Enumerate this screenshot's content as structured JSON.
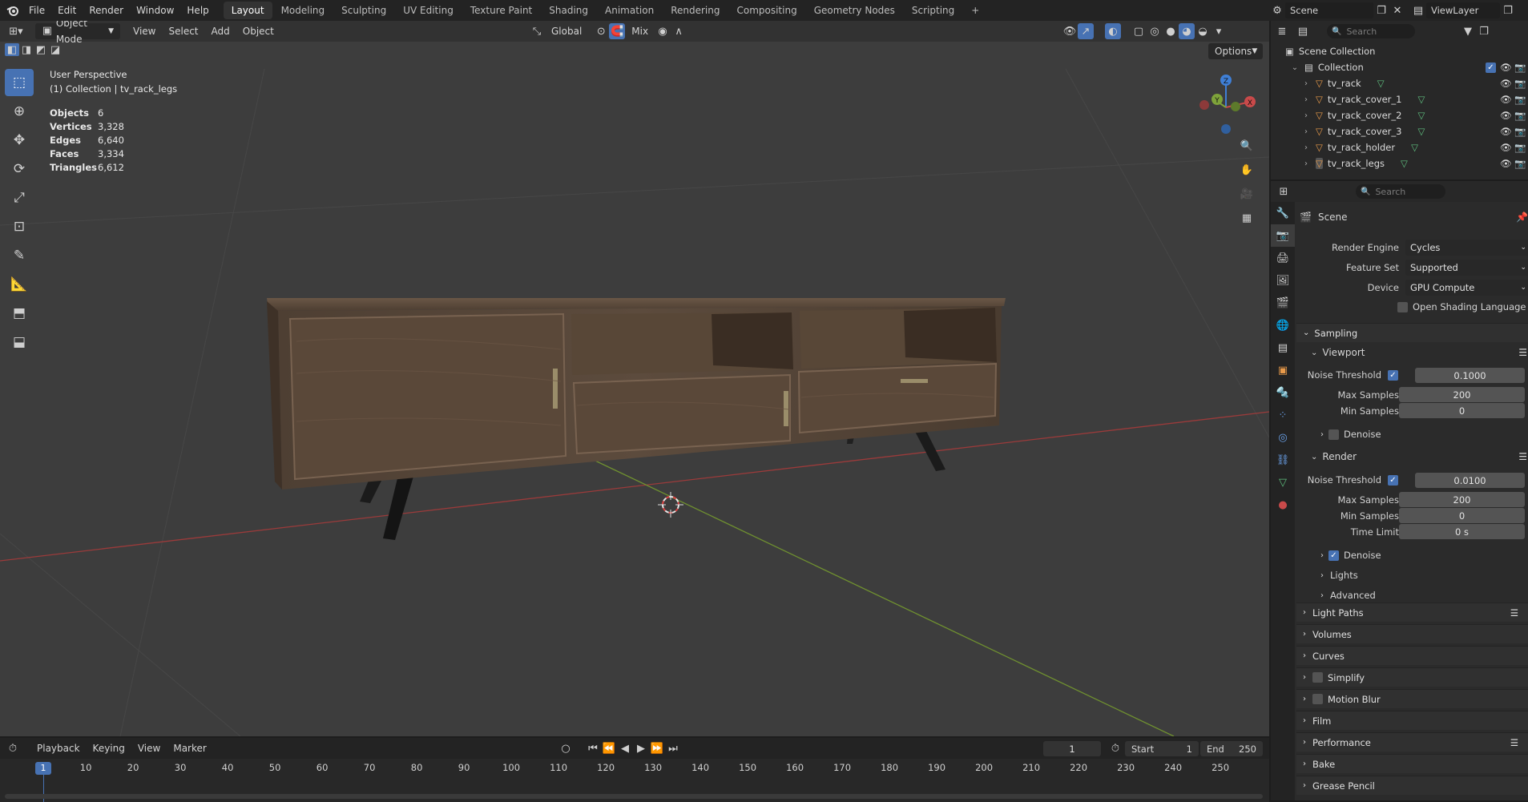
{
  "topbar": {
    "menus": [
      "File",
      "Edit",
      "Render",
      "Window",
      "Help"
    ],
    "workspaces": [
      "Layout",
      "Modeling",
      "Sculpting",
      "UV Editing",
      "Texture Paint",
      "Shading",
      "Animation",
      "Rendering",
      "Compositing",
      "Geometry Nodes",
      "Scripting"
    ],
    "active_workspace": "Layout",
    "add_tab": "+",
    "scene_name": "Scene",
    "view_layer": "ViewLayer"
  },
  "viewport": {
    "mode": "Object Mode",
    "menus": [
      "View",
      "Select",
      "Add",
      "Object"
    ],
    "transform_orientation": "Global",
    "snap_mode": "Mix",
    "options_label": "Options",
    "overlay_title": "User Perspective",
    "overlay_subtitle": "(1) Collection | tv_rack_legs",
    "stats": [
      {
        "label": "Objects",
        "value": "6"
      },
      {
        "label": "Vertices",
        "value": "3,328"
      },
      {
        "label": "Edges",
        "value": "6,640"
      },
      {
        "label": "Faces",
        "value": "3,334"
      },
      {
        "label": "Triangles",
        "value": "6,612"
      }
    ],
    "gizmo_axes": [
      "Z",
      "Y",
      "X"
    ]
  },
  "outliner": {
    "search_placeholder": "Search",
    "root": "Scene Collection",
    "collection": "Collection",
    "objects": [
      "tv_rack",
      "tv_rack_cover_1",
      "tv_rack_cover_2",
      "tv_rack_cover_3",
      "tv_rack_holder",
      "tv_rack_legs"
    ]
  },
  "properties": {
    "search_placeholder": "Search",
    "context": "Scene",
    "render_engine_label": "Render Engine",
    "render_engine": "Cycles",
    "feature_set_label": "Feature Set",
    "feature_set": "Supported",
    "device_label": "Device",
    "device": "GPU Compute",
    "osl_label": "Open Shading Language",
    "sampling": "Sampling",
    "viewport": "Viewport",
    "render": "Render",
    "noise_threshold_label": "Noise Threshold",
    "viewport_noise_threshold": "0.1000",
    "max_samples_label": "Max Samples",
    "viewport_max_samples": "200",
    "min_samples_label": "Min Samples",
    "viewport_min_samples": "0",
    "denoise_label": "Denoise",
    "render_noise_threshold": "0.0100",
    "render_max_samples": "200",
    "render_min_samples": "0",
    "time_limit_label": "Time Limit",
    "time_limit": "0 s",
    "lights": "Lights",
    "advanced": "Advanced",
    "panels": [
      "Light Paths",
      "Volumes",
      "Curves",
      "Simplify",
      "Motion Blur",
      "Film",
      "Performance",
      "Bake",
      "Grease Pencil"
    ]
  },
  "timeline": {
    "menus": [
      "Playback",
      "Keying",
      "View",
      "Marker"
    ],
    "current_frame": "1",
    "start_label": "Start",
    "start": "1",
    "end_label": "End",
    "end": "250",
    "ticks": [
      "10",
      "20",
      "30",
      "40",
      "50",
      "60",
      "70",
      "80",
      "90",
      "100",
      "110",
      "120",
      "130",
      "140",
      "150",
      "160",
      "170",
      "180",
      "190",
      "200",
      "210",
      "220",
      "230",
      "240",
      "250"
    ],
    "playhead": "1"
  },
  "colors": {
    "accent": "#4772b3",
    "x_axis": "#c94a4a",
    "y_axis": "#7ea33a",
    "z_axis": "#3f7fd6",
    "object_icon": "#e89a4a",
    "mesh_icon": "#5fbf7f"
  }
}
